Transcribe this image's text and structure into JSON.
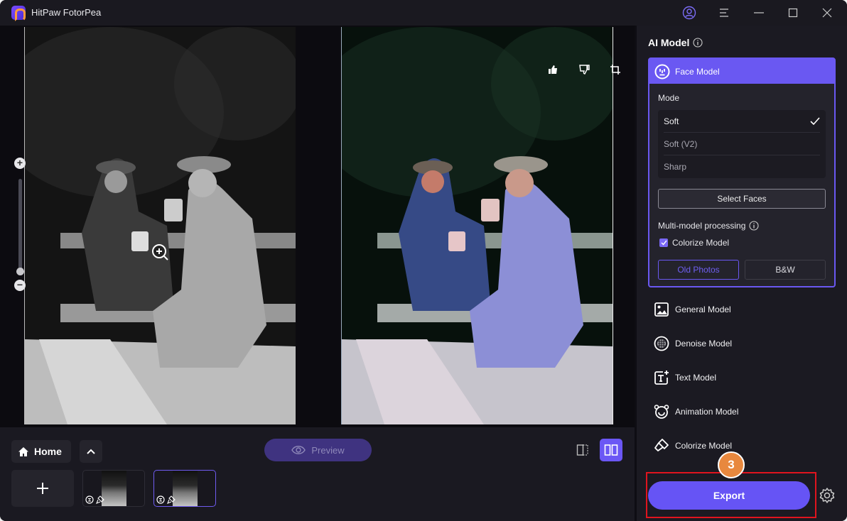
{
  "app": {
    "title": "HitPaw FotorPea",
    "window_controls": [
      "account-icon",
      "menu-icon",
      "minimize-icon",
      "maximize-icon",
      "close-icon"
    ]
  },
  "canvas": {
    "zoom_controls": {
      "zoom_in": "+",
      "zoom_out": "−",
      "zoom_level_fraction": 0.0
    },
    "result_actions": [
      "thumbs-up-icon",
      "thumbs-down-icon",
      "crop-icon"
    ],
    "images": {
      "original": "black-and-white photo of two men on a bench",
      "result": "colorized photo of two men on a bench"
    }
  },
  "bottom_bar": {
    "home_label": "Home",
    "preview_label": "Preview",
    "add_label": "+",
    "thumbnails": [
      {
        "active": false,
        "badges": [
          "face-model-icon",
          "colorize-model-icon"
        ]
      },
      {
        "active": true,
        "badges": [
          "face-model-icon",
          "colorize-model-icon"
        ]
      }
    ],
    "view_modes": [
      {
        "name": "split-view",
        "active": false
      },
      {
        "name": "side-by-side-view",
        "active": true
      }
    ]
  },
  "panel": {
    "title": "AI Model",
    "face_model": {
      "label": "Face Model",
      "mode_label": "Mode",
      "modes": [
        {
          "label": "Soft",
          "selected": true
        },
        {
          "label": "Soft (V2)",
          "selected": false
        },
        {
          "label": "Sharp",
          "selected": false
        }
      ],
      "select_faces_label": "Select Faces",
      "multi_model_label": "Multi-model processing",
      "colorize_checkbox": {
        "label": "Colorize Model",
        "checked": true
      },
      "colorize_options": [
        {
          "label": "Old Photos",
          "selected": true
        },
        {
          "label": "B&W",
          "selected": false
        }
      ]
    },
    "models": [
      {
        "label": "General Model",
        "icon": "image-icon"
      },
      {
        "label": "Denoise Model",
        "icon": "denoise-icon"
      },
      {
        "label": "Text Model",
        "icon": "text-icon"
      },
      {
        "label": "Animation Model",
        "icon": "animation-icon"
      },
      {
        "label": "Colorize Model",
        "icon": "brush-icon"
      }
    ],
    "export_label": "Export",
    "step_badge": "3"
  },
  "colors": {
    "accent": "#6a58f2",
    "badge": "#e8883e",
    "highlight_frame": "#e0141e",
    "background": "#1b1a22"
  }
}
